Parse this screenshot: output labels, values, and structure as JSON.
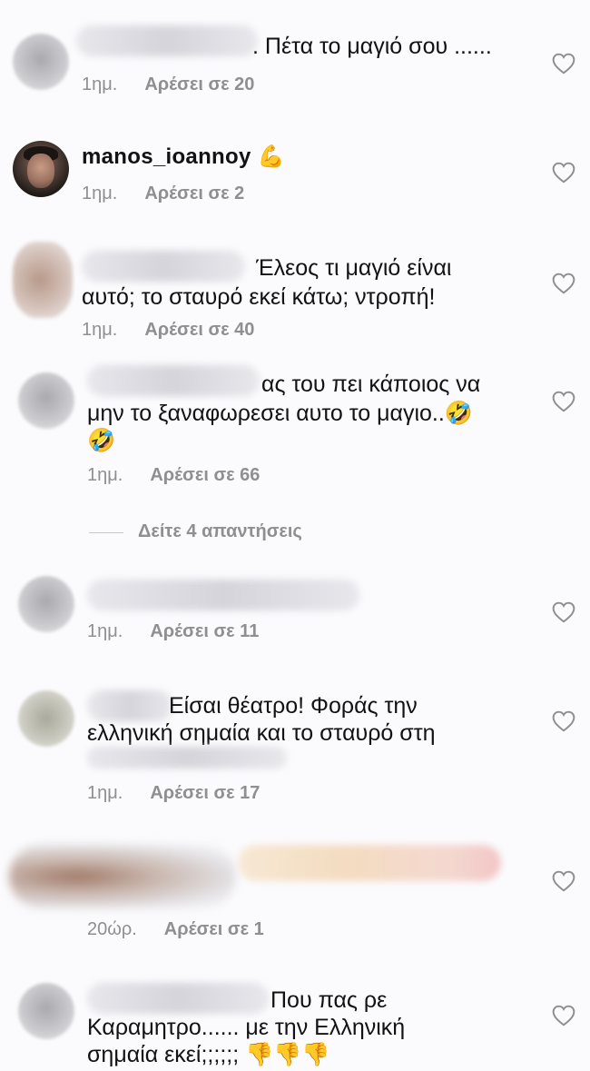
{
  "comments": [
    {
      "user": "",
      "text": ". Πέτα το μαγιό σου ......",
      "time": "1ημ.",
      "likes": "Αρέσει σε 20"
    },
    {
      "user": "manos_ioannoy",
      "text": "💪",
      "time": "1ημ.",
      "likes": "Αρέσει σε 2"
    },
    {
      "user": "",
      "line1": "Έλεος τι μαγιό είναι",
      "line2": "αυτό; το σταυρό εκεί κάτω; ντροπή!",
      "time": "1ημ.",
      "likes": "Αρέσει σε 40"
    },
    {
      "user": "",
      "line1": "ας του πει κάποιος να",
      "line2": "μην το ξαναφωρεσει  αυτο το μαγιο..🤣",
      "line3": "🤣",
      "time": "1ημ.",
      "likes": "Αρέσει σε 66"
    },
    {
      "user": "",
      "text": "",
      "time": "1ημ.",
      "likes": "Αρέσει σε 11"
    },
    {
      "user": "",
      "line1": "Είσαι θέατρο! Φοράς την",
      "line2": "ελληνική σημαία και το σταυρό στη",
      "time": "1ημ.",
      "likes": "Αρέσει σε 17"
    },
    {
      "user": "",
      "text": "",
      "time": "20ώρ.",
      "likes": "Αρέσει σε 1"
    },
    {
      "user": "",
      "line1": "Που πας ρε",
      "line2": "Καραμητρο...... με την Ελληνική",
      "line3": "σημαία εκεί;;;;;; 👎👎👎"
    }
  ],
  "replies_label": "Δείτε 4 απαντήσεις",
  "icons": {
    "like": "heart-outline-icon"
  }
}
